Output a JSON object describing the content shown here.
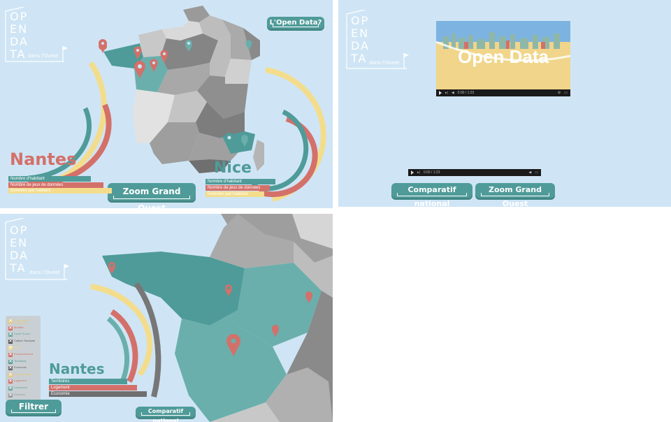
{
  "logo": {
    "letters": [
      "OP",
      "EN",
      "DA",
      "TA"
    ],
    "tagline": "dans l'Ouest"
  },
  "panel1": {
    "open_data_button": "L'Open Data?",
    "zoom_button": "Zoom Grand Ouest",
    "cities": [
      {
        "name": "Nantes",
        "legend": [
          "Nombre d'habitant",
          "Nombre de jeux de données",
          "Données par habitant"
        ]
      },
      {
        "name": "Nice",
        "legend": [
          "Nombre d'habitant",
          "Nombre de jeux de données",
          "Données par habitant"
        ]
      }
    ]
  },
  "panel2": {
    "video_title": "Open Data",
    "video_time": "0:00 / 1:23",
    "player_time": "0:00 / 1:23",
    "comparatif_button": "Comparatif national",
    "zoom_button": "Zoom Grand Ouest"
  },
  "panel3": {
    "city": "Nantes",
    "legend": [
      "Territoires",
      "Logement",
      "Economie"
    ],
    "filters": [
      {
        "label": "Citoyenneté Institution",
        "color": "#e9c97a"
      },
      {
        "label": "Mobilité",
        "color": "#d4706a"
      },
      {
        "label": "Santé Social",
        "color": "#6aa7a5"
      },
      {
        "label": "Culture Tourisme",
        "color": "#555555"
      },
      {
        "label": "Sport",
        "color": "#efd88e"
      },
      {
        "label": "Environnement",
        "color": "#d4706a"
      },
      {
        "label": "Territoires",
        "color": "#4f9b99"
      },
      {
        "label": "Economie",
        "color": "#666666"
      },
      {
        "label": "Enseignement",
        "color": "#e9c97a"
      },
      {
        "label": "Logement",
        "color": "#d4706a"
      },
      {
        "label": "Urbanisme",
        "color": "#6aa7a5"
      },
      {
        "label": "Données",
        "color": "#999999"
      }
    ],
    "filter_button": "Filtrer",
    "comparatif_button": "Comparatif national"
  },
  "colors": {
    "teal": "#4f9b99",
    "light_teal": "#6aafac",
    "red": "#d4706a",
    "yellow": "#f3dd8c",
    "grey": "#7d7d7d",
    "bg": "#cfe5f5"
  }
}
